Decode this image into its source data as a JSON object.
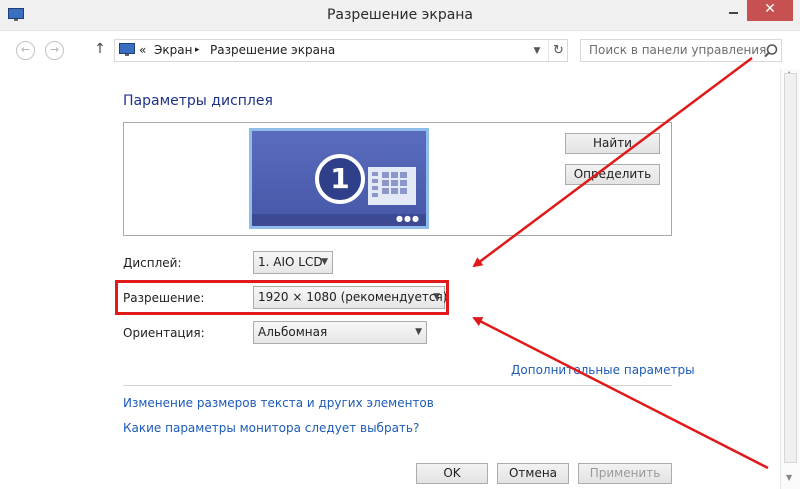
{
  "window": {
    "title": "Разрешение экрана",
    "close_symbol": "✕"
  },
  "nav": {
    "back_icon": "back-arrow-icon",
    "forward_icon": "forward-arrow-icon",
    "up_icon": "up-arrow-icon",
    "address": {
      "overflow": "«",
      "crumbs": [
        "Экран",
        "Разрешение экрана"
      ],
      "separator": "▸"
    },
    "search_placeholder": "Поиск в панели управления"
  },
  "main": {
    "section_title": "Параметры дисплея",
    "monitor_number": "1",
    "find_button": "Найти",
    "detect_button": "Определить",
    "display_label": "Дисплей:",
    "display_value": "1. AIO LCD",
    "resolution_label": "Разрешение:",
    "resolution_value": "1920 × 1080 (рекомендуется)",
    "orientation_label": "Ориентация:",
    "orientation_value": "Альбомная",
    "advanced_link": "Дополнительные параметры",
    "text_size_link": "Изменение размеров текста и других элементов",
    "which_settings_link": "Какие параметры монитора следует выбрать?"
  },
  "footer": {
    "ok": "OK",
    "cancel": "Отмена",
    "apply": "Применить"
  },
  "colors": {
    "annotation": "#e0191a",
    "link": "#1c5bb8",
    "heading": "#1e3287"
  }
}
